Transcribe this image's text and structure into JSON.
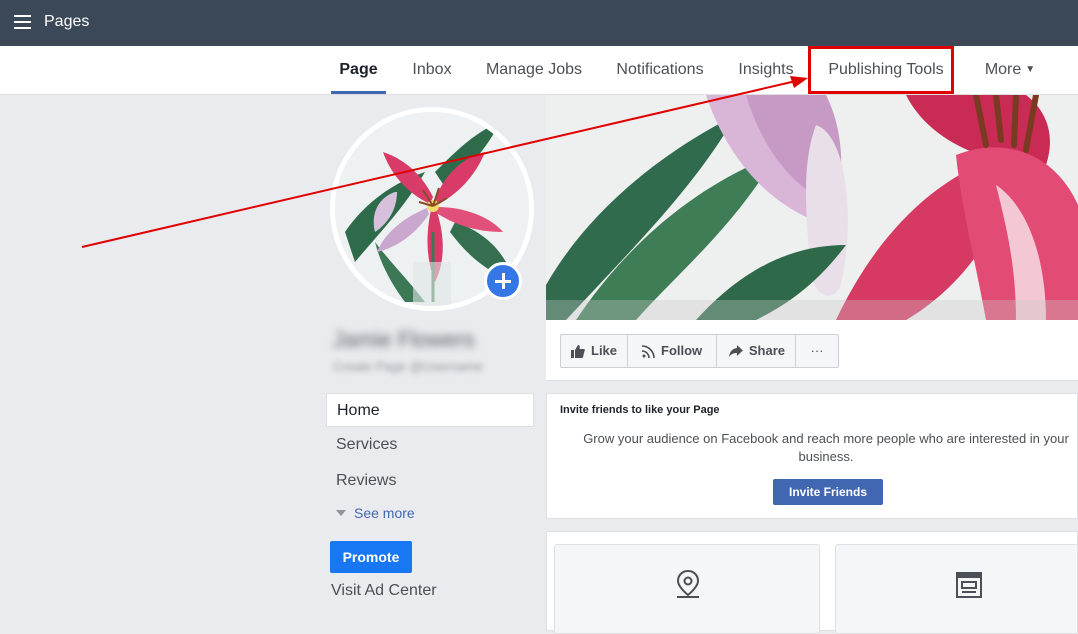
{
  "topbar": {
    "title": "Pages"
  },
  "nav": {
    "tabs": [
      {
        "label": "Page"
      },
      {
        "label": "Inbox"
      },
      {
        "label": "Manage Jobs"
      },
      {
        "label": "Notifications"
      },
      {
        "label": "Insights"
      },
      {
        "label": "Publishing Tools"
      },
      {
        "label": "More"
      }
    ]
  },
  "profile": {
    "name": "Jamie Flowers",
    "handle": "Create Page @Username"
  },
  "left_nav": {
    "items": [
      {
        "label": "Home"
      },
      {
        "label": "Services"
      },
      {
        "label": "Reviews"
      }
    ],
    "see_more": "See more",
    "promote": "Promote",
    "visit_ad_center": "Visit Ad Center"
  },
  "actions": {
    "like": "Like",
    "follow": "Follow",
    "share": "Share",
    "more": "···"
  },
  "invite": {
    "title": "Invite friends to like your Page",
    "text": "Grow your audience on Facebook and reach more people who are interested in your business.",
    "button": "Invite Friends"
  },
  "colors": {
    "topbar": "#3b4858",
    "accent": "#4267b2",
    "promote": "#1877f2",
    "highlight": "#e00000"
  }
}
